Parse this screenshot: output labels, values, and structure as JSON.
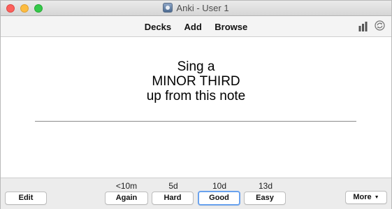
{
  "window": {
    "title": "Anki - User 1"
  },
  "toolbar": {
    "links": [
      "Decks",
      "Add",
      "Browse"
    ],
    "icons": [
      "stats-icon",
      "sync-icon"
    ]
  },
  "card": {
    "question_lines": [
      "Sing a",
      "MINOR THIRD",
      "up from this note"
    ]
  },
  "bottombar": {
    "edit_label": "Edit",
    "more_label": "More",
    "answers": [
      {
        "interval": "<10m",
        "label": "Again"
      },
      {
        "interval": "5d",
        "label": "Hard"
      },
      {
        "interval": "10d",
        "label": "Good"
      },
      {
        "interval": "13d",
        "label": "Easy"
      }
    ]
  },
  "colors": {
    "close": "#fc605c",
    "minimize": "#fdbc40",
    "maximize": "#34c84a",
    "focus_ring": "#6aa2ee"
  }
}
